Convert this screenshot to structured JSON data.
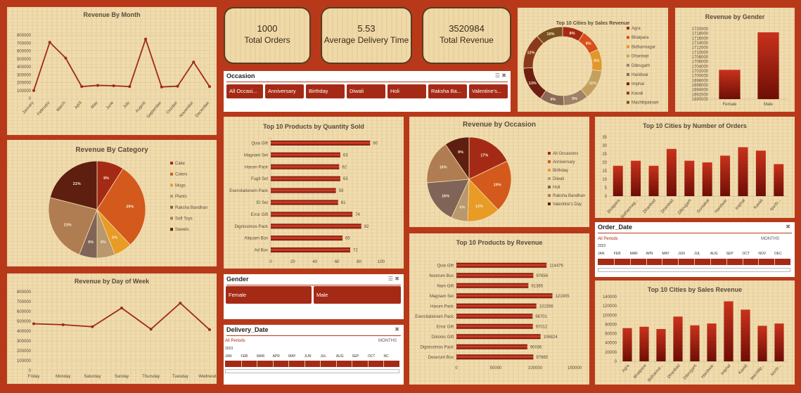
{
  "kpis": {
    "orders": {
      "value": "1000",
      "label": "Total Orders"
    },
    "delivery": {
      "value": "5.53",
      "label": "Average Delivery Time"
    },
    "revenue": {
      "value": "3520984",
      "label": "Total Revenue"
    }
  },
  "colors": {
    "bar": "#9e1c0c",
    "line": "#9e2a18",
    "primary": "#a52a16",
    "bg": "#b8391a"
  },
  "chart_data": [
    {
      "id": "revenue_by_month",
      "type": "line",
      "title": "Revenue By Month",
      "categories": [
        "January",
        "February",
        "March",
        "April",
        "May",
        "June",
        "July",
        "August",
        "September",
        "October",
        "November",
        "December"
      ],
      "values": [
        100000,
        710000,
        510000,
        150000,
        165000,
        160000,
        150000,
        750000,
        145000,
        155000,
        460000,
        150000
      ],
      "ylim": [
        0,
        800000
      ],
      "yticks": [
        "0",
        "100000",
        "200000",
        "300000",
        "400000",
        "500000",
        "600000",
        "700000",
        "800000"
      ],
      "grid": true
    },
    {
      "id": "top_cities_sales_donut",
      "type": "pie",
      "title": "Top 10 Cities by Sales Revenue",
      "categories": [
        "Agra",
        "Bhatpara",
        "Bidhannagar",
        "Dhanbad",
        "Dibrugarh",
        "Haridwar",
        "Imphal",
        "Kavali",
        "Machilipatnam"
      ],
      "values": [
        8,
        8,
        8,
        11,
        9,
        9,
        13,
        13,
        10
      ],
      "labels": [
        "8%",
        "8%",
        "8%",
        "11%",
        "9%",
        "9%",
        "13%",
        "13%",
        "10%"
      ],
      "legend": "right"
    },
    {
      "id": "revenue_by_gender",
      "type": "bar",
      "title": "Revenue by Gender",
      "categories": [
        "Female",
        "Male"
      ],
      "values": [
        1702500,
        1718500
      ],
      "ylim": [
        1690000,
        1720000
      ],
      "yticks": [
        "1690000",
        "1692000",
        "1694000",
        "1696000",
        "1698000",
        "1700000",
        "1702000",
        "1704000",
        "1706000",
        "1708000",
        "1710000",
        "1712000",
        "1714000",
        "1716000",
        "1718000",
        "1720000"
      ]
    },
    {
      "id": "revenue_by_category",
      "type": "pie",
      "title": "Revenue By Category",
      "categories": [
        "Cake",
        "Colors",
        "Mugs",
        "Plants",
        "Raksha Bandhan",
        "Soft Toys",
        "Sweets"
      ],
      "values": [
        9,
        29,
        6,
        6,
        6,
        23,
        21
      ],
      "labels": [
        "9%",
        "29%",
        "6%",
        "6%",
        "6%",
        "23%",
        "21%"
      ],
      "legend": "right"
    },
    {
      "id": "top_products_qty",
      "type": "bar",
      "orientation": "horizontal",
      "title": "Top 10 Products by Quantity Sold",
      "categories": [
        "Quia Gift",
        "Magnam Set",
        "Harum Pack",
        "Fugit Set",
        "Exercitationem Pack",
        "Et Set",
        "Error Gift",
        "Dignissimos Pack",
        "Aliquam Box",
        "Ad Box"
      ],
      "values": [
        90,
        63,
        62,
        63,
        59,
        61,
        74,
        82,
        65,
        72
      ],
      "xlim": [
        0,
        100
      ],
      "xticks": [
        "0",
        "20",
        "40",
        "60",
        "80",
        "100"
      ]
    },
    {
      "id": "revenue_by_occasion",
      "type": "pie",
      "title": "Revenue by Occasion",
      "categories": [
        "All Occasions",
        "Anniversary",
        "Birthday",
        "Diwali",
        "Holi",
        "Raksha Bandhan",
        "Valentine's Day"
      ],
      "values": [
        17,
        19,
        12,
        6,
        16,
        16,
        9
      ],
      "labels": [
        "17%",
        "19%",
        "12%",
        "6%",
        "16%",
        "16%",
        "9%"
      ],
      "legend": "right"
    },
    {
      "id": "top_cities_orders",
      "type": "bar",
      "title": "Top 10 Cities by Number of Orders",
      "categories": [
        "Bhatpara",
        "Bidhannag...",
        "Dhanbad",
        "Dhanbad",
        "Dibrugarh",
        "Guntakal",
        "Haridwar",
        "Imphal",
        "Kavali",
        "North..."
      ],
      "values": [
        18,
        21,
        18,
        28,
        21,
        20,
        24,
        29,
        27,
        19
      ],
      "ylim": [
        0,
        35
      ],
      "yticks": [
        "0",
        "5",
        "10",
        "15",
        "20",
        "25",
        "30",
        "35"
      ]
    },
    {
      "id": "revenue_by_day",
      "type": "line",
      "title": "Revenue by Day of Week",
      "categories": [
        "Friday",
        "Monday",
        "Saturday",
        "Sunday",
        "Thursday",
        "Tuesday",
        "Wednesday"
      ],
      "values": [
        475000,
        465000,
        445000,
        635000,
        420000,
        685000,
        415000
      ],
      "ylim": [
        0,
        800000
      ],
      "yticks": [
        "0",
        "100000",
        "200000",
        "300000",
        "400000",
        "500000",
        "600000",
        "700000",
        "800000"
      ],
      "grid": true
    },
    {
      "id": "top_products_revenue",
      "type": "bar",
      "orientation": "horizontal",
      "title": "Top 10 Products by Revenue",
      "categories": [
        "Quia Gift",
        "Nostrum Box",
        "Nam Gift",
        "Magnam Set",
        "Harum Pack",
        "Exercitationem Pack",
        "Error Gift",
        "Dolores Gift",
        "Dignissimos Pack",
        "Deserunt Box"
      ],
      "values": [
        114476,
        97656,
        91385,
        121905,
        101556,
        96701,
        97012,
        106824,
        90036,
        97665
      ],
      "labels": [
        "114476",
        "97656",
        "91385",
        "121905",
        "101556",
        "96701",
        "97012",
        "106824",
        "90036",
        "97665"
      ],
      "xlim": [
        0,
        150000
      ],
      "xticks": [
        "0",
        "50000",
        "100000",
        "150000"
      ]
    },
    {
      "id": "top_cities_sales_bar",
      "type": "bar",
      "title": "Top 10 Cities by Sales Revenue",
      "categories": [
        "Agra",
        "Bhatpara",
        "Bidhanna...",
        "Dhanbad",
        "Dibrugarh",
        "Haridwar",
        "Imphal",
        "Kavali",
        "Machilip...",
        "North..."
      ],
      "values": [
        72000,
        75000,
        70000,
        97000,
        78000,
        82000,
        130000,
        112000,
        77000,
        82000
      ],
      "ylim": [
        0,
        140000
      ],
      "yticks": [
        "0",
        "20000",
        "40000",
        "60000",
        "80000",
        "100000",
        "120000",
        "140000"
      ]
    }
  ],
  "slicers": {
    "occasion": {
      "title": "Occasion",
      "items": [
        "All Occasi...",
        "Anniversary",
        "Birthday",
        "Diwali",
        "Holi",
        "Raksha Ba...",
        "Valentine's..."
      ]
    },
    "gender": {
      "title": "Gender",
      "items": [
        "Female",
        "Male"
      ]
    }
  },
  "timelines": {
    "order": {
      "title": "Order_Date",
      "periods": "All Periods",
      "unit": "MONTHS",
      "year": "2023",
      "months": [
        "JAN",
        "FEB",
        "MAR",
        "APR",
        "MAY",
        "JUN",
        "JUL",
        "AUG",
        "SEP",
        "OCT",
        "NOV",
        "DEC"
      ]
    },
    "delivery": {
      "title": "Delivery_Date",
      "periods": "All Periods",
      "unit": "MONTHS",
      "year": "2023",
      "months": [
        "JAN",
        "FEB",
        "MAR",
        "APR",
        "MAY",
        "JUN",
        "JUL",
        "AUG",
        "SEP",
        "OCT",
        "NC"
      ]
    }
  }
}
